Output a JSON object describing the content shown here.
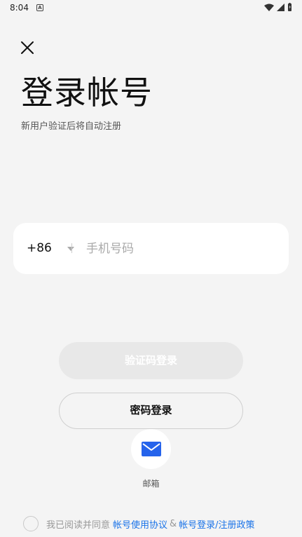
{
  "status_bar": {
    "time": "8:04",
    "app_indicator": "A"
  },
  "header": {
    "title": "登录帐号",
    "subtitle": "新用户验证后将自动注册"
  },
  "phone": {
    "country_code": "+86",
    "placeholder": "手机号码",
    "value": ""
  },
  "buttons": {
    "sms_login": "验证码登录",
    "password_login": "密码登录"
  },
  "alt_login": {
    "mail_label": "邮箱"
  },
  "agreement": {
    "prefix": "我已阅读并同意",
    "terms_link": "帐号使用协议",
    "amp": "&",
    "policy_link": "帐号登录/注册政策",
    "link_color": "#1a73e8"
  },
  "colors": {
    "mail_icon": "#2563eb"
  }
}
